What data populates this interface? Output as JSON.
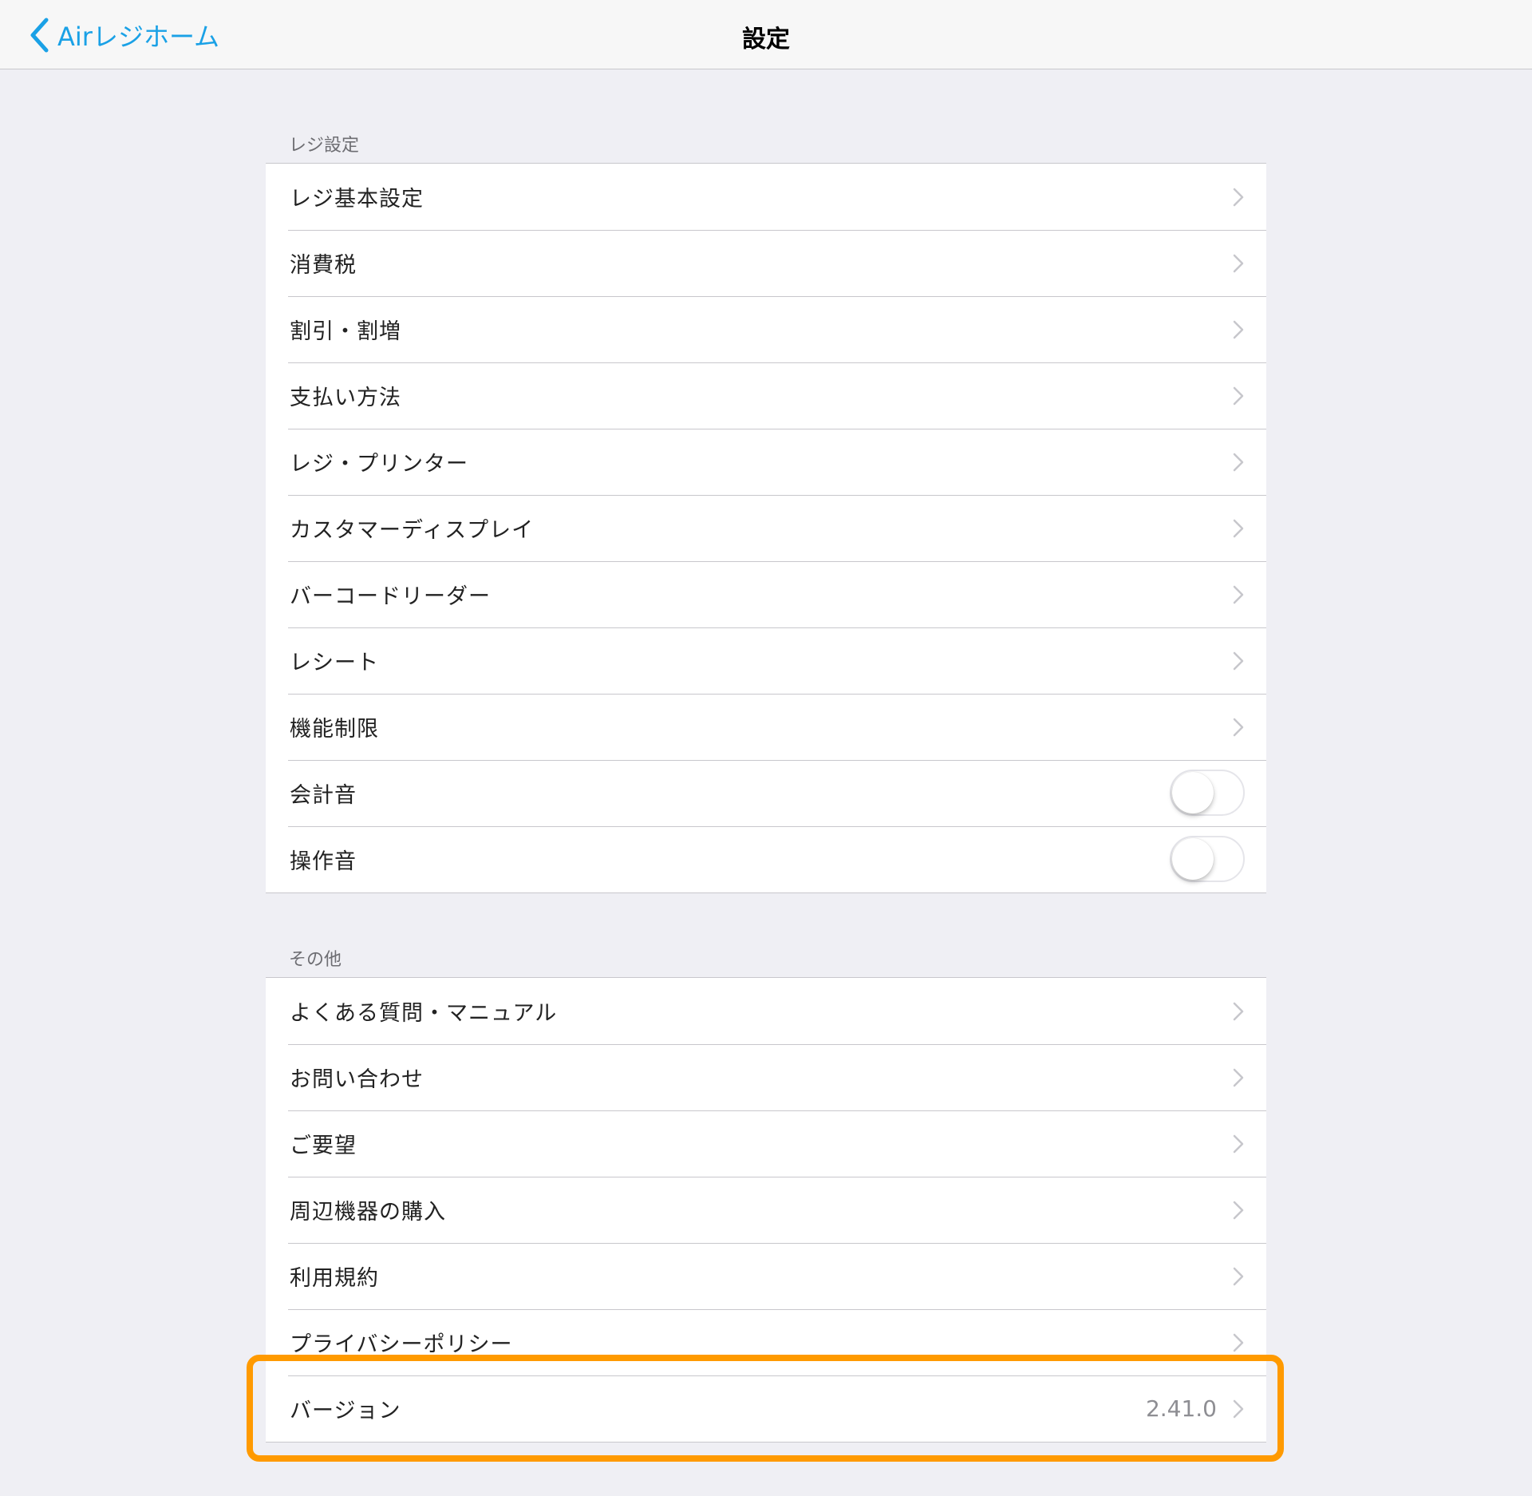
{
  "navbar": {
    "back_label": "Airレジホーム",
    "title": "設定"
  },
  "sections": [
    {
      "header": "レジ設定",
      "items": [
        {
          "label": "レジ基本設定",
          "type": "link"
        },
        {
          "label": "消費税",
          "type": "link"
        },
        {
          "label": "割引・割増",
          "type": "link"
        },
        {
          "label": "支払い方法",
          "type": "link"
        },
        {
          "label": "レジ・プリンター",
          "type": "link"
        },
        {
          "label": "カスタマーディスプレイ",
          "type": "link"
        },
        {
          "label": "バーコードリーダー",
          "type": "link"
        },
        {
          "label": "レシート",
          "type": "link"
        },
        {
          "label": "機能制限",
          "type": "link"
        },
        {
          "label": "会計音",
          "type": "toggle",
          "on": false
        },
        {
          "label": "操作音",
          "type": "toggle",
          "on": false
        }
      ]
    },
    {
      "header": "その他",
      "items": [
        {
          "label": "よくある質問・マニュアル",
          "type": "link"
        },
        {
          "label": "お問い合わせ",
          "type": "link"
        },
        {
          "label": "ご要望",
          "type": "link"
        },
        {
          "label": "周辺機器の購入",
          "type": "link"
        },
        {
          "label": "利用規約",
          "type": "link"
        },
        {
          "label": "プライバシーポリシー",
          "type": "link"
        },
        {
          "label": "バージョン",
          "type": "link",
          "value": "2.41.0"
        }
      ]
    }
  ],
  "colors": {
    "accent": "#1aa1e6",
    "highlight": "#ff9a00",
    "background": "#efeff4"
  }
}
